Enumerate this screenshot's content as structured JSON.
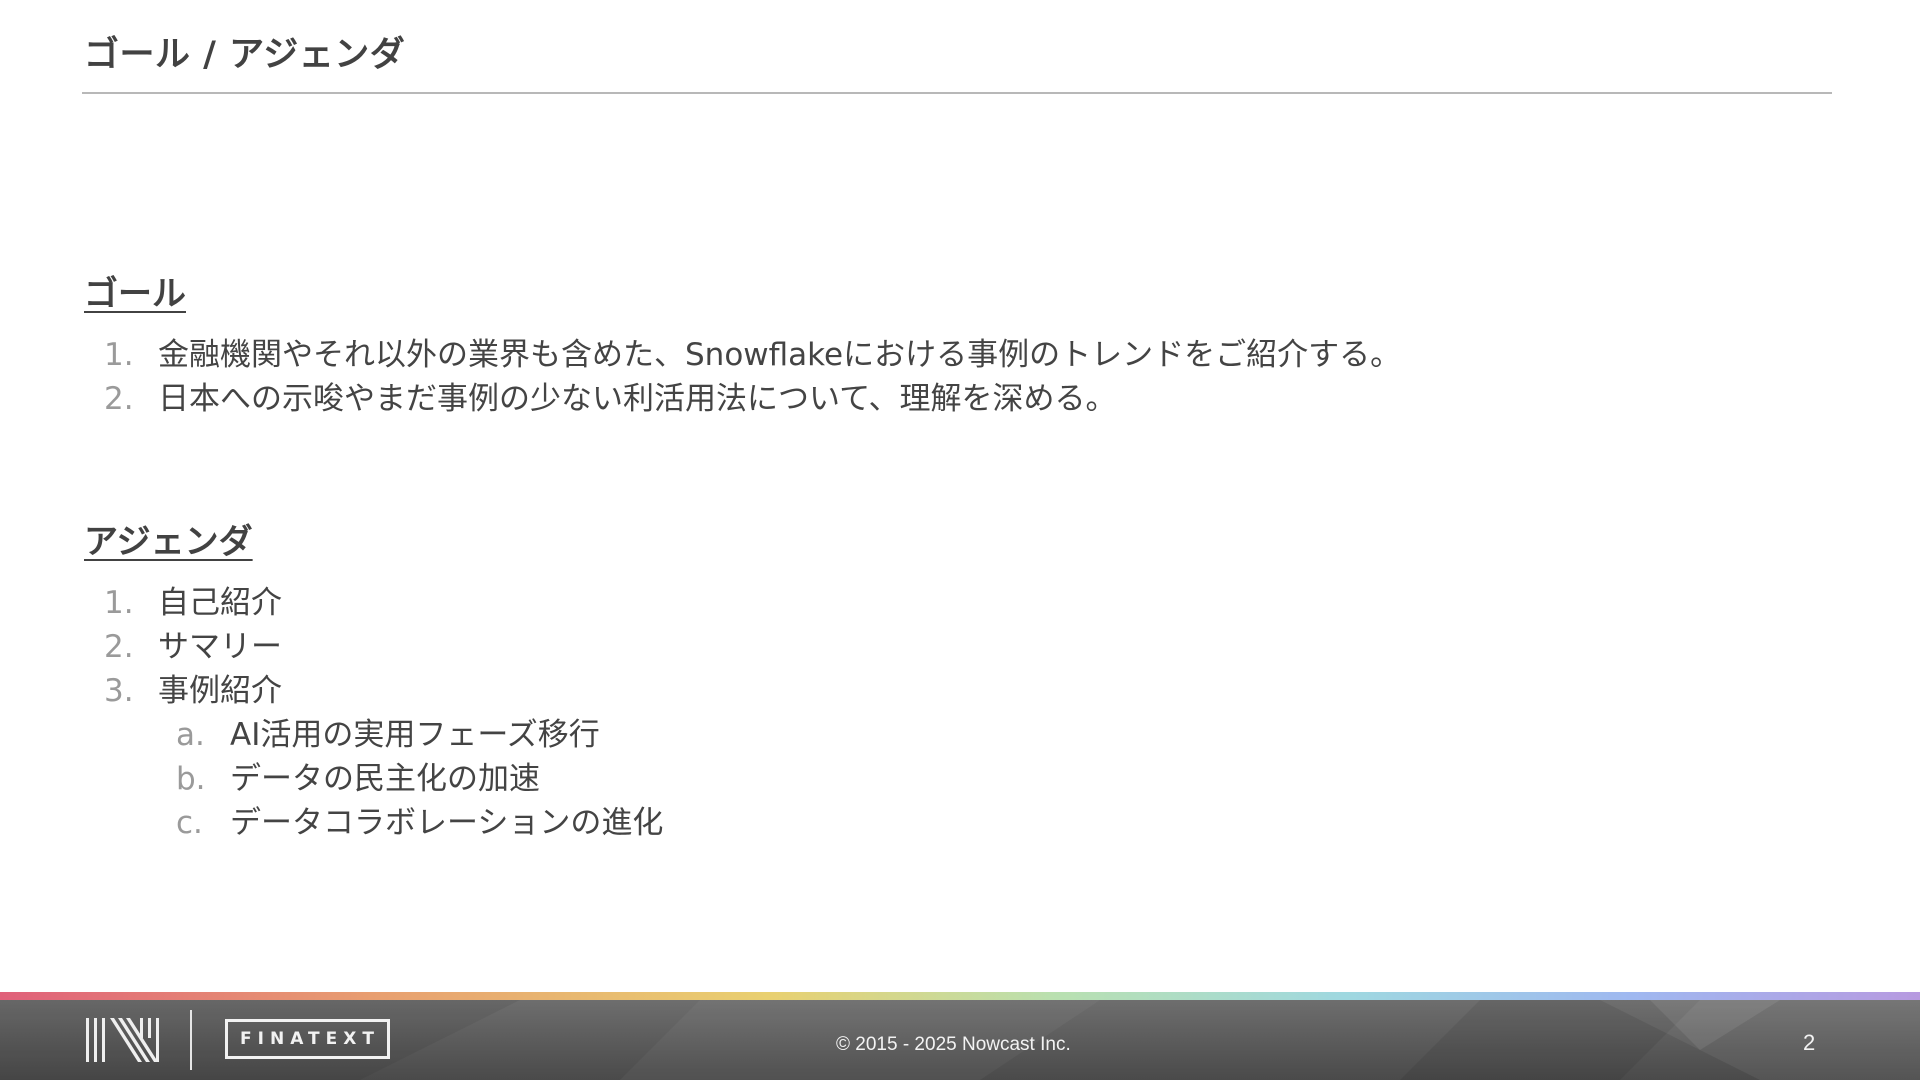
{
  "slide": {
    "title": "ゴール / アジェンダ"
  },
  "goal": {
    "heading": "ゴール",
    "items": [
      {
        "marker": "1.",
        "text": "金融機関やそれ以外の業界も含めた、Snowflakeにおける事例のトレンドをご紹介する。"
      },
      {
        "marker": "2.",
        "text": "日本への示唆やまだ事例の少ない利活用法について、理解を深める。"
      }
    ]
  },
  "agenda": {
    "heading": "アジェンダ",
    "items": [
      {
        "marker": "1.",
        "text": "自己紹介"
      },
      {
        "marker": "2.",
        "text": "サマリー"
      },
      {
        "marker": "3.",
        "text": "事例紹介"
      }
    ],
    "sub_items": [
      {
        "marker": "a.",
        "text": "AI活用の実用フェーズ移行"
      },
      {
        "marker": "b.",
        "text": "データの民主化の加速"
      },
      {
        "marker": "c.",
        "text": "データコラボレーションの進化"
      }
    ]
  },
  "footer": {
    "logo_text": "FINATEXT",
    "copyright": "© 2015 - 2025 Nowcast Inc.",
    "page_number": "2"
  },
  "colors": {
    "text": "#444444",
    "marker": "#9a9a9a",
    "footer_background": "#5a5a5a",
    "footer_text": "#f3f3f3"
  }
}
